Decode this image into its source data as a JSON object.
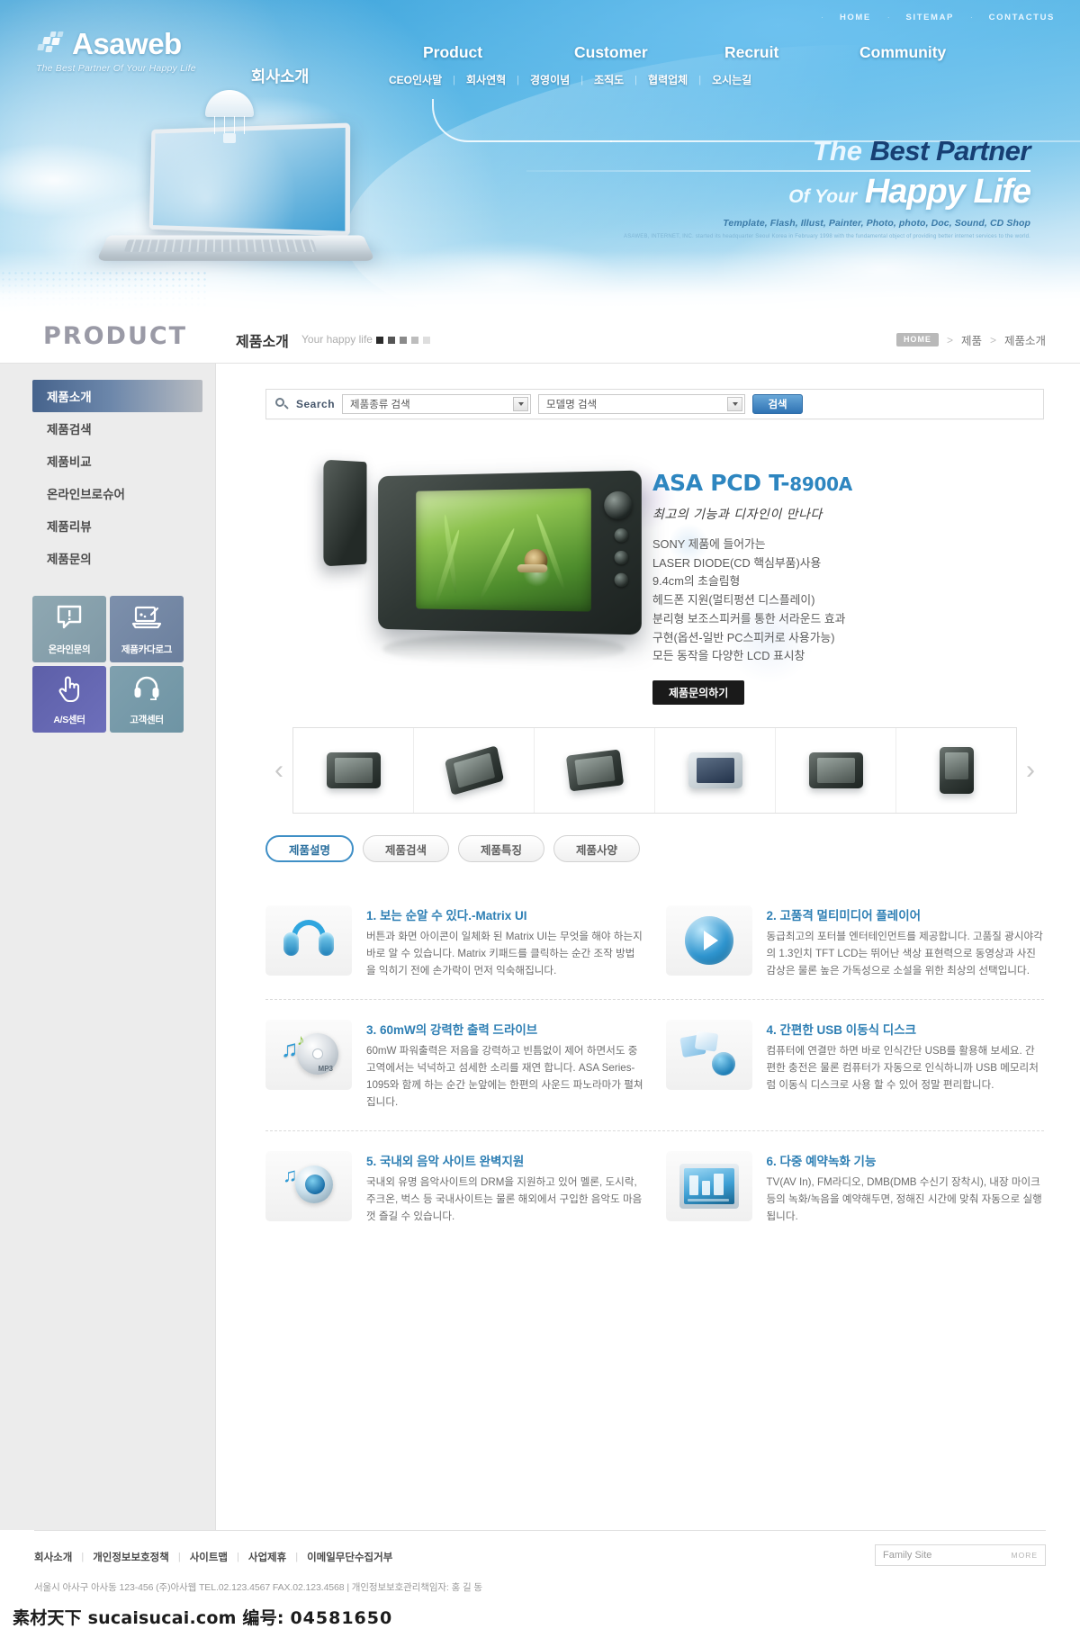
{
  "header": {
    "logo": {
      "text": "Asaweb",
      "tagline": "The Best Partner Of Your Happy Life"
    },
    "utility": [
      {
        "label": "HOME"
      },
      {
        "label": "SITEMAP"
      },
      {
        "label": "CONTACTUS"
      }
    ],
    "gnb": [
      {
        "label": "회사소개"
      },
      {
        "label": "Product"
      },
      {
        "label": "Customer"
      },
      {
        "label": "Recruit"
      },
      {
        "label": "Community"
      }
    ],
    "subnav": [
      {
        "label": "CEO인사말"
      },
      {
        "label": "회사연혁"
      },
      {
        "label": "경영이념"
      },
      {
        "label": "조직도"
      },
      {
        "label": "협력업체"
      },
      {
        "label": "오시는길"
      }
    ]
  },
  "hero": {
    "line1_a": "The",
    "line1_b": "Best Partner",
    "line2_a": "Of Your",
    "line2_b": "Happy Life",
    "subtitle": "Template, Flash, Illust, Painter, Photo, photo, Doc, Sound, CD Shop",
    "fineprint": "ASAWEB, INTERNET, INC. started its headquarter Seoul Korea in February 1998 with the fundamental object of providing better internet services to the world."
  },
  "title_bar": {
    "big_title": "PRODUCT",
    "ko_title": "제품소개",
    "en_subtitle": "Your happy life",
    "squares": [
      "#2a2a2a",
      "#555555",
      "#8a8a8a",
      "#bdbdbd",
      "#dedede"
    ],
    "breadcrumb": {
      "home": "HOME",
      "items": [
        "제품",
        "제품소개"
      ],
      "separator": ">"
    }
  },
  "sidebar": {
    "menu": [
      {
        "label": "제품소개",
        "active": true
      },
      {
        "label": "제품검색",
        "active": false
      },
      {
        "label": "제품비교",
        "active": false
      },
      {
        "label": "온라인브로슈어",
        "active": false
      },
      {
        "label": "제품리뷰",
        "active": false
      },
      {
        "label": "제품문의",
        "active": false
      }
    ],
    "quick_links": [
      {
        "label": "온라인문의",
        "icon": "speech-bubble-exclamation-icon"
      },
      {
        "label": "제품카다로그",
        "icon": "laptop-pen-icon"
      },
      {
        "label": "A/S센터",
        "icon": "pointing-hand-icon"
      },
      {
        "label": "고객센터",
        "icon": "headset-icon"
      }
    ]
  },
  "search": {
    "icon": "search-icon",
    "label": "Search",
    "category_value": "제품종류 검색",
    "model_value": "모델명 검색",
    "button_label": "검색"
  },
  "product": {
    "name_main": "ASA PCD T-",
    "name_model": "8900A",
    "tagline": "최고의 기능과 디자인이 만나다",
    "specs": [
      "SONY 제품에 들어가는",
      "LASER DIODE(CD 핵심부품)사용",
      "9.4cm의 초슬림형",
      "헤드폰 지원(멀티펑션 디스플레이)",
      "분리형 보조스피커를 통한 서라운드 효과",
      "구현(옵션-일반 PC스피커로 사용가능)",
      "모든 동작을 다양한 LCD 표시창"
    ],
    "inquiry_button": "제품문의하기",
    "carousel": {
      "prev_icon": "chevron-left-icon",
      "next_icon": "chevron-right-icon",
      "thumbnails": [
        {
          "name": "pmp-front-view"
        },
        {
          "name": "pmp-tilted-stand-view"
        },
        {
          "name": "pmp-angled-view"
        },
        {
          "name": "laptop-view"
        },
        {
          "name": "pmp-dark-view"
        },
        {
          "name": "pmp-handheld-view"
        }
      ]
    }
  },
  "tabs": [
    {
      "label": "제품설명",
      "active": true
    },
    {
      "label": "제품검색",
      "active": false
    },
    {
      "label": "제품특징",
      "active": false
    },
    {
      "label": "제품사양",
      "active": false
    }
  ],
  "features": [
    {
      "icon": "headphones-icon",
      "title": "1. 보는 순알 수 있다.-Matrix UI",
      "desc": "버튼과 화면 아이콘이 일체화 된 Matrix UI는 무엇을 해야 하는지 바로 알 수 있습니다. Matrix 키패드를 클릭하는 순간 조작 방법을 익히기 전에 손가락이 먼저 익숙해집니다."
    },
    {
      "icon": "play-button-icon",
      "title": "2. 고품격 멀티미디어 플레이어",
      "desc": "동급최고의 포터블 엔터테인먼트를 제공합니다. 고품질 광시야각의 1.3인치 TFT LCD는 뛰어난 색상 표현력으로 동영상과 사진 감상은 물론 높은 가독성으로 소설을 위한 최상의 선택입니다."
    },
    {
      "icon": "mp3-cd-icon",
      "title": "3. 60mW의 강력한 출력 드라이브",
      "desc": "60mW 파워출력은 저음을 강력하고 빈틈없이 제어 하면서도 중고역에서는 넉넉하고 섬세한 소리를 재연 합니다. ASA Series-1095와 함께 하는 순간 눈앞에는 한편의 사운드 파노라마가 펼쳐집니다."
    },
    {
      "icon": "usb-disk-icon",
      "title": "4. 간편한 USB 이동식 디스크",
      "desc": "컴퓨터에 연결만 하면 바로 인식간단 USB를 활용해 보세요. 간편한 충전은 물론 컴퓨터가 자동으로 인식하니까 USB 메모리처럼 이동식 디스크로 사용 할 수 있어 정말 편리합니다."
    },
    {
      "icon": "music-eye-icon",
      "title": "5. 국내외 음악 사이트 완벽지원",
      "desc": "국내외 유명 음악사이트의 DRM을 지원하고 있어 멜론, 도시락, 주크온, 벅스 등 국내사이트는 물론 해외에서 구입한 음악도 마음껏 즐길 수 있습니다."
    },
    {
      "icon": "tv-recording-icon",
      "title": "6. 다중 예약녹화 기능",
      "desc": "TV(AV In), FM라디오, DMB(DMB 수신기 장착시), 내장 마이크 등의 녹화/녹음을 예약해두면, 정해진 시간에 맞춰 자동으로 실행됩니다."
    }
  ],
  "footer": {
    "links": [
      {
        "label": "회사소개"
      },
      {
        "label": "개인정보보호정책"
      },
      {
        "label": "사이트맵"
      },
      {
        "label": "사업제휴"
      },
      {
        "label": "이메일무단수집거부"
      }
    ],
    "separator": "|",
    "address": "서울시 아사구 아사동 123-456 (주)아사웹 TEL.02.123.4567 FAX.02.123.4568 | 개인정보보호관리책임자: 홍 길 동",
    "family_site": {
      "label": "Family Site",
      "more": "MORE"
    }
  },
  "watermark": {
    "text": "素材天下 sucaisucai.com  编号:",
    "code": "04581650"
  }
}
